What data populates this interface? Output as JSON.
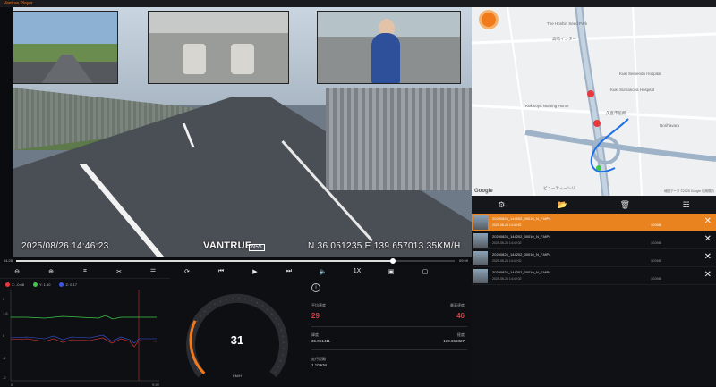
{
  "app": {
    "title": "Vantrue Player"
  },
  "video": {
    "osd_datetime": "2025/08/26 14:46:23",
    "osd_brand": "VANTRUE",
    "osd_model": "N5S",
    "osd_coords": "N 36.051235   E 139.657013   35KM/H"
  },
  "progress": {
    "elapsed": "04:28",
    "total": "09:59",
    "fraction": 0.86
  },
  "controls": [
    {
      "name": "zoom-out-icon",
      "glyph": "⊖"
    },
    {
      "name": "zoom-in-icon",
      "glyph": "⊕"
    },
    {
      "name": "screenshot-icon",
      "glyph": "⌗"
    },
    {
      "name": "cut-icon",
      "glyph": "✂"
    },
    {
      "name": "adjust-icon",
      "glyph": "☰"
    },
    {
      "name": "rotate-icon",
      "glyph": "⟳"
    },
    {
      "name": "previous-icon",
      "glyph": "⏮"
    },
    {
      "name": "play-icon",
      "glyph": "▶"
    },
    {
      "name": "next-icon",
      "glyph": "⏭"
    },
    {
      "name": "volume-icon",
      "glyph": "🔈"
    },
    {
      "name": "speed-label",
      "glyph": "1X"
    },
    {
      "name": "pip-icon",
      "glyph": "▣"
    },
    {
      "name": "fullscreen-icon",
      "glyph": "▢"
    }
  ],
  "graph": {
    "legend": [
      {
        "label": "X: -0.08",
        "color": "#e8383d"
      },
      {
        "label": "Y: 1.10",
        "color": "#3ec84b"
      },
      {
        "label": "Z: 0.17",
        "color": "#3b57e8"
      }
    ],
    "y_ticks": [
      "2",
      "1.6",
      "0",
      "-1",
      "-2"
    ],
    "x_ticks": [
      "0",
      "9:59"
    ]
  },
  "gauge": {
    "speed": "31",
    "unit": "KM/H",
    "fraction": 0.26,
    "accent": "#f07a1c"
  },
  "info": {
    "avg_speed_label": "平均速度",
    "avg_speed": "29",
    "max_speed_label": "最高速度",
    "max_speed": "46",
    "lat_label": "緯度",
    "lat": "36.051411",
    "lng_label": "経度",
    "lng": "139.656827",
    "distance_label": "走行距離",
    "distance": "1.10 KM"
  },
  "map": {
    "labels": [
      "The Hoshin Seed Park",
      "高崎インター",
      "Kuki Seinendo Hospital",
      "Kuki Sumanoya Hospital",
      "Kukinoya Nursing Home",
      "久喜市役所",
      "ビューティーシリ",
      "Norihavara"
    ],
    "google": "Google",
    "credit": "地図データ ©2025 Google 利用規約"
  },
  "playlist": {
    "toolbar": [
      {
        "name": "settings-icon",
        "glyph": "⚙"
      },
      {
        "name": "open-folder-icon",
        "glyph": "📂"
      },
      {
        "name": "delete-icon",
        "glyph": "🗑"
      },
      {
        "name": "sort-icon",
        "glyph": "☷"
      }
    ],
    "items": [
      {
        "file": "20250826_144052_00010_N_F.MP4",
        "date": "2025-08-26 14:40:52",
        "size": "1G0MB",
        "active": true
      },
      {
        "file": "20250826_144202_00010_N_F.MP4",
        "date": "2025-08-26 14:42:02",
        "size": "1G0MB",
        "active": false
      },
      {
        "file": "20250826_144202_00010_N_F.MP4",
        "date": "2025-08-26 14:42:02",
        "size": "1G0MB",
        "active": false
      },
      {
        "file": "20250826_144202_00010_N_F.MP4",
        "date": "2025-08-26 14:42:02",
        "size": "1G0MB",
        "active": false
      }
    ]
  }
}
